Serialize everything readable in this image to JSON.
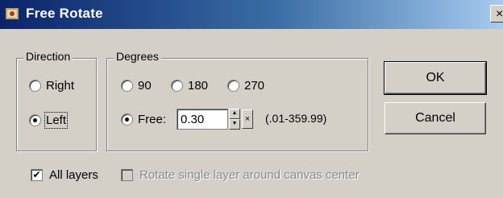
{
  "window": {
    "title": "Free Rotate",
    "close_glyph": "×",
    "icon": "app-icon"
  },
  "direction": {
    "legend": "Direction",
    "options": [
      {
        "label": "Right",
        "selected": false
      },
      {
        "label": "Left",
        "selected": true
      }
    ]
  },
  "degrees": {
    "legend": "Degrees",
    "options": [
      {
        "label": "90",
        "selected": false
      },
      {
        "label": "180",
        "selected": false
      },
      {
        "label": "270",
        "selected": false
      }
    ],
    "free": {
      "label": "Free:",
      "selected": true,
      "value": "0.30",
      "range": "(.01-359.99)"
    }
  },
  "buttons": {
    "ok": "OK",
    "cancel": "Cancel"
  },
  "all_layers": {
    "label": "All layers",
    "checked": true
  },
  "rotate_single": {
    "label": "Rotate single layer around canvas center",
    "checked": false,
    "enabled": false
  }
}
